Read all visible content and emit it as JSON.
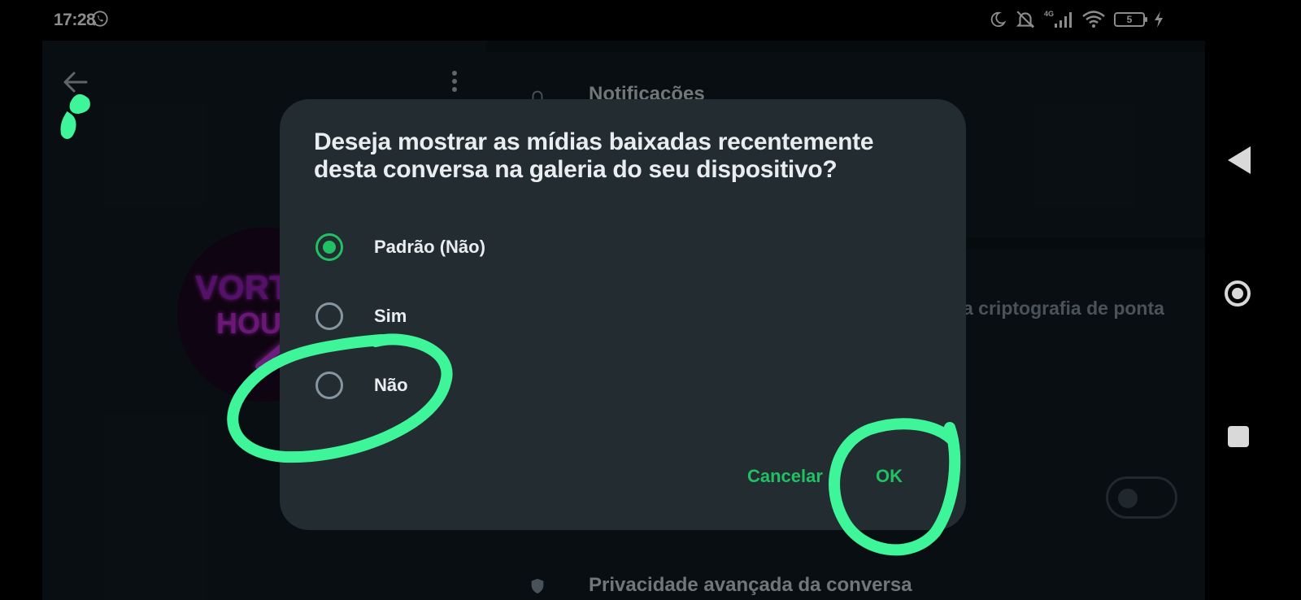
{
  "status_bar": {
    "time": "17:28",
    "network_label": "4G",
    "battery_level": "5"
  },
  "background": {
    "avatar_line1": "VORT",
    "avatar_line2": "HOU",
    "notifications_label": "Notificações",
    "encryption_text": "a criptografia de ponta",
    "advanced_privacy_label": "Privacidade avançada da conversa"
  },
  "dialog": {
    "title": "Deseja mostrar as mídias baixadas recentemente desta conversa na galeria do seu dispositivo?",
    "options": [
      {
        "label": "Padrão (Não)",
        "selected": true
      },
      {
        "label": "Sim",
        "selected": false
      },
      {
        "label": "Não",
        "selected": false
      }
    ],
    "cancel_label": "Cancelar",
    "ok_label": "OK"
  },
  "colors": {
    "accent": "#21c063",
    "annotation": "#3ef59a",
    "dialog_bg": "#222c31"
  }
}
